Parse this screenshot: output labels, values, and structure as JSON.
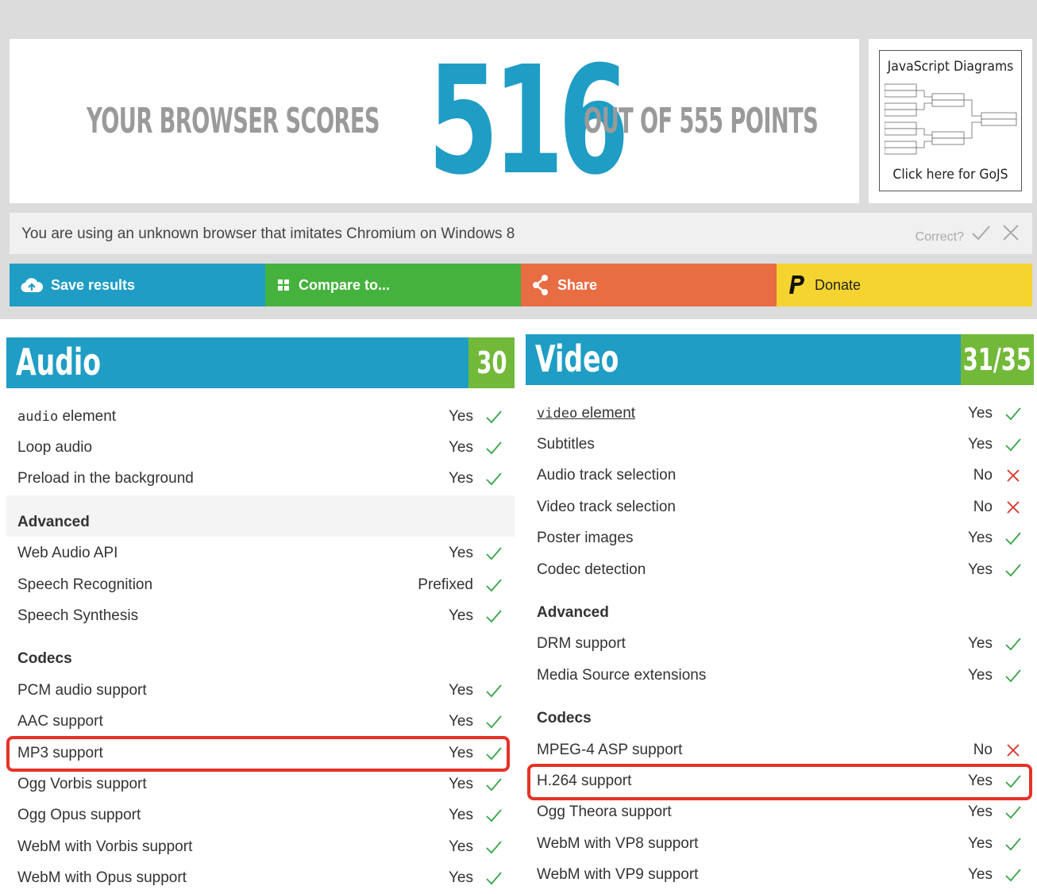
{
  "score": {
    "prefix": "YOUR BROWSER SCORES",
    "value": "516",
    "suffix": "OUT OF 555 POINTS"
  },
  "ad": {
    "title": "JavaScript Diagrams",
    "cta": "Click here for GoJS"
  },
  "browser_info": {
    "text": "You are using an unknown browser that imitates Chromium on Windows 8",
    "correct_label": "Correct?"
  },
  "actions": [
    {
      "label": "Save results",
      "icon": "cloud-upload-icon",
      "color": "#1f9dc5"
    },
    {
      "label": "Compare to...",
      "icon": "grid-icon",
      "color": "#45b23d"
    },
    {
      "label": "Share",
      "icon": "share-icon",
      "color": "#e96d43"
    },
    {
      "label": "Donate",
      "icon": "paypal-icon",
      "color": "#f5d430"
    }
  ],
  "colors": {
    "accent_blue": "#1f9dc5",
    "score_green": "#72b93a",
    "yes_green": "#3aa64a",
    "no_red": "#d9342b",
    "highlight_red": "#e53327"
  },
  "audio": {
    "title": "Audio",
    "score": "30",
    "rows": [
      {
        "type": "item",
        "code": "audio",
        "label": " element",
        "value": "Yes",
        "ok": true
      },
      {
        "type": "item",
        "label": "Loop audio",
        "value": "Yes",
        "ok": true
      },
      {
        "type": "item",
        "label": "Preload in the background",
        "value": "Yes",
        "ok": true
      },
      {
        "type": "section",
        "label": "Advanced"
      },
      {
        "type": "item",
        "label": "Web Audio API",
        "value": "Yes",
        "ok": true
      },
      {
        "type": "item",
        "label": "Speech Recognition",
        "value": "Prefixed",
        "ok": true
      },
      {
        "type": "item",
        "label": "Speech Synthesis",
        "value": "Yes",
        "ok": true
      },
      {
        "type": "section",
        "label": "Codecs"
      },
      {
        "type": "item",
        "label": "PCM audio support",
        "value": "Yes",
        "ok": true
      },
      {
        "type": "item",
        "label": "AAC support",
        "value": "Yes",
        "ok": true
      },
      {
        "type": "item",
        "label": "MP3 support",
        "value": "Yes",
        "ok": true,
        "highlight": true
      },
      {
        "type": "item",
        "label": "Ogg Vorbis support",
        "value": "Yes",
        "ok": true
      },
      {
        "type": "item",
        "label": "Ogg Opus support",
        "value": "Yes",
        "ok": true
      },
      {
        "type": "item",
        "label": "WebM with Vorbis support",
        "value": "Yes",
        "ok": true
      },
      {
        "type": "item",
        "label": "WebM with Opus support",
        "value": "Yes",
        "ok": true
      }
    ]
  },
  "video": {
    "title": "Video",
    "score": "31/35",
    "rows": [
      {
        "type": "item",
        "code": "video",
        "label": " element",
        "value": "Yes",
        "ok": true,
        "link": true
      },
      {
        "type": "item",
        "label": "Subtitles",
        "value": "Yes",
        "ok": true
      },
      {
        "type": "item",
        "label": "Audio track selection",
        "value": "No",
        "ok": false
      },
      {
        "type": "item",
        "label": "Video track selection",
        "value": "No",
        "ok": false
      },
      {
        "type": "item",
        "label": "Poster images",
        "value": "Yes",
        "ok": true
      },
      {
        "type": "item",
        "label": "Codec detection",
        "value": "Yes",
        "ok": true
      },
      {
        "type": "section",
        "label": "Advanced"
      },
      {
        "type": "item",
        "label": "DRM support",
        "value": "Yes",
        "ok": true
      },
      {
        "type": "item",
        "label": "Media Source extensions",
        "value": "Yes",
        "ok": true
      },
      {
        "type": "section",
        "label": "Codecs"
      },
      {
        "type": "item",
        "label": "MPEG-4 ASP support",
        "value": "No",
        "ok": false
      },
      {
        "type": "item",
        "label": "H.264 support",
        "value": "Yes",
        "ok": true,
        "highlight": true
      },
      {
        "type": "item",
        "label": "Ogg Theora support",
        "value": "Yes",
        "ok": true
      },
      {
        "type": "item",
        "label": "WebM with VP8 support",
        "value": "Yes",
        "ok": true
      },
      {
        "type": "item",
        "label": "WebM with VP9 support",
        "value": "Yes",
        "ok": true
      }
    ]
  }
}
